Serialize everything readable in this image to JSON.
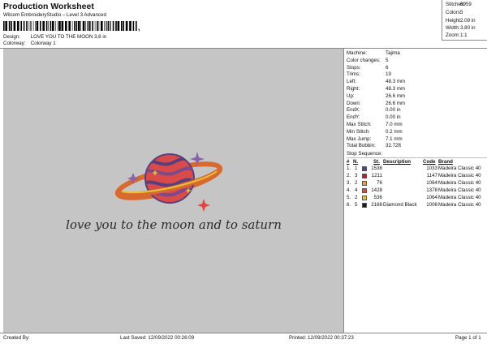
{
  "header": {
    "title": "Production Worksheet",
    "subtitle": "Wilcom EmbroideryStudio – Level 3 Advanced",
    "barcode_suffix": ",",
    "design_label": "Design:",
    "design_value": "LOVE YOU TO THE MOON 3,8 in",
    "colorway_label": "Colorway:",
    "colorway_value": "Colorway 1"
  },
  "stats": [
    {
      "label": "Stitches:",
      "value": "6959"
    },
    {
      "label": "Colors:",
      "value": "5"
    },
    {
      "label": "Height:",
      "value": "2.09 in"
    },
    {
      "label": "Width:",
      "value": "3.80 in"
    },
    {
      "label": "Zoom:",
      "value": "1:1"
    }
  ],
  "machine_info": [
    {
      "label": "Machine:",
      "value": "Tajima"
    },
    {
      "label": "Color changes:",
      "value": "5"
    },
    {
      "label": "Stops:",
      "value": "6"
    },
    {
      "label": "Trims:",
      "value": "19"
    },
    {
      "label": "Left:",
      "value": "48.3 mm"
    },
    {
      "label": "Right:",
      "value": "48.3 mm"
    },
    {
      "label": "Up:",
      "value": "26.6 mm"
    },
    {
      "label": "Down:",
      "value": "26.6 mm"
    },
    {
      "label": "EndX:",
      "value": "0.00 in"
    },
    {
      "label": "EndY:",
      "value": "0.00 in"
    },
    {
      "label": "Max Stitch:",
      "value": "7.0 mm"
    },
    {
      "label": "Min Stitch:",
      "value": "0.2 mm"
    },
    {
      "label": "Max Jump:",
      "value": "7.1 mm"
    },
    {
      "label": "Total Bobbin:",
      "value": "32.72ft"
    }
  ],
  "stop_sequence": {
    "title": "Stop Sequence:",
    "headers": {
      "num": "#",
      "n": "N.",
      "st": "St.",
      "description": "Description",
      "code": "Code",
      "brand": "Brand"
    },
    "rows": [
      {
        "num": "1.",
        "n": "1",
        "color": "#5a3f7d",
        "st": "1538",
        "description": "",
        "code": "1033",
        "brand": "Madeira Classic 40"
      },
      {
        "num": "2.",
        "n": "3",
        "color": "#c0182d",
        "st": "1211",
        "description": "",
        "code": "1147",
        "brand": "Madeira Classic 40"
      },
      {
        "num": "3.",
        "n": "2",
        "color": "#e8a23a",
        "st": "76",
        "description": "",
        "code": "1064",
        "brand": "Madeira Classic 40"
      },
      {
        "num": "4.",
        "n": "4",
        "color": "#e2453b",
        "st": "1428",
        "description": "",
        "code": "1378",
        "brand": "Madeira Classic 40"
      },
      {
        "num": "5.",
        "n": "2",
        "color": "#e8c23a",
        "st": "536",
        "description": "",
        "code": "1064",
        "brand": "Madeira Classic 40"
      },
      {
        "num": "6.",
        "n": "5",
        "color": "#1b1b1b",
        "st": "2168",
        "description": "Diamond Black",
        "code": "1006",
        "brand": "Madeira Classic 40"
      }
    ]
  },
  "design": {
    "text": "love you to the moon and to saturn"
  },
  "footer": {
    "created_by": "Created By:",
    "last_saved": "Last Saved: 12/09/2022 00:26:09",
    "printed": "Printed: 12/09/2022 00:37:23",
    "page": "Page 1 of 1"
  }
}
